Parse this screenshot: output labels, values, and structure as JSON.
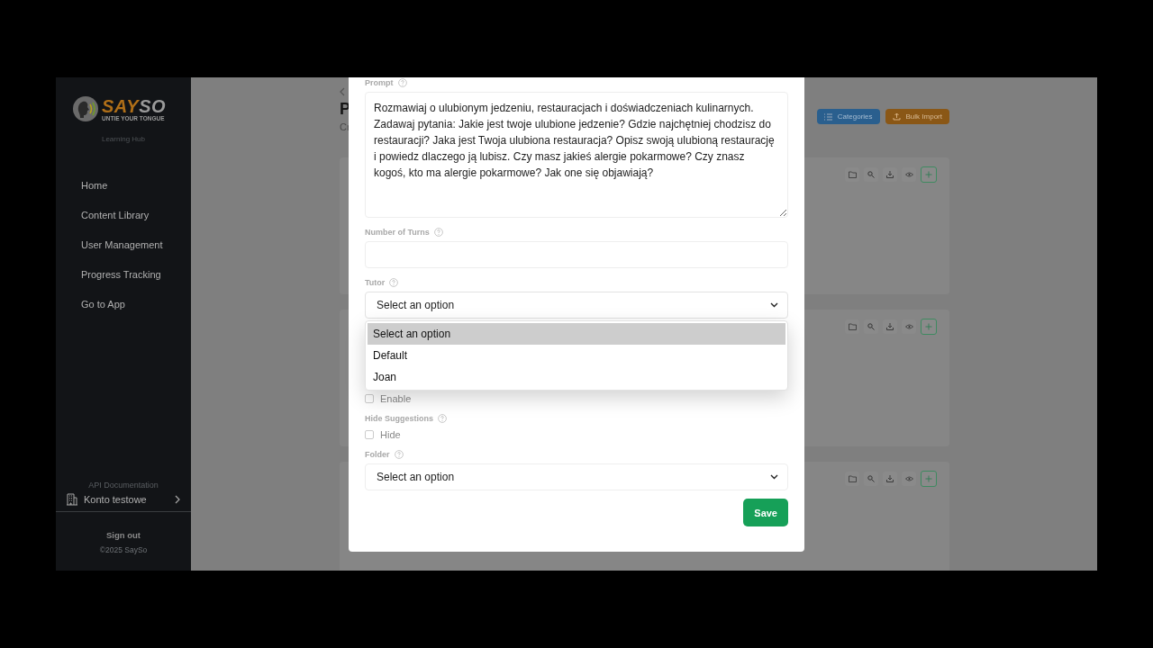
{
  "brand": {
    "wordmark_a": "SAY",
    "wordmark_b": "SO",
    "tagline": "UNTIE YOUR TONGUE",
    "subtitle": "Learning Hub"
  },
  "sidebar": {
    "items": [
      {
        "label": "Home"
      },
      {
        "label": "Content Library"
      },
      {
        "label": "User Management"
      },
      {
        "label": "Progress Tracking"
      },
      {
        "label": "Go to App"
      }
    ],
    "faded_link": "API Documentation",
    "account": "Konto testowe",
    "sign_out": "Sign out",
    "copyright": "©2025 SaySo"
  },
  "page": {
    "title": "P",
    "subtitle": "Cr",
    "buttons": [
      {
        "label": "Categories",
        "kind": "categories"
      },
      {
        "label": "Bulk Import",
        "kind": "import"
      }
    ]
  },
  "modal": {
    "prompt": {
      "label": "Prompt",
      "value": "Rozmawiaj o ulubionym jedzeniu, restauracjach i doświadczeniach kulinarnych. Zadawaj pytania: Jakie jest twoje ulubione jedzenie? Gdzie najchętniej chodzisz do restauracji? Jaka jest Twoja ulubiona restauracja? Opisz swoją ulubioną restaurację i powiedz dlaczego ją lubisz. Czy masz jakieś alergie pokarmowe? Czy znasz kogoś, kto ma alergie pokarmowe? Jak one się objawiają?"
    },
    "turns": {
      "label": "Number of Turns"
    },
    "tutor": {
      "label": "Tutor",
      "value": "Select an option",
      "expanded": true,
      "options": [
        {
          "label": "Select an option",
          "selected": true
        },
        {
          "label": "Default",
          "selected": false
        },
        {
          "label": "Joan",
          "selected": false
        }
      ]
    },
    "enable": {
      "option": "Enable",
      "checked": false
    },
    "hide_suggestions": {
      "label": "Hide Suggestions",
      "option": "Hide",
      "checked": false
    },
    "folder": {
      "label": "Folder",
      "value": "Select an option"
    },
    "save": "Save"
  }
}
